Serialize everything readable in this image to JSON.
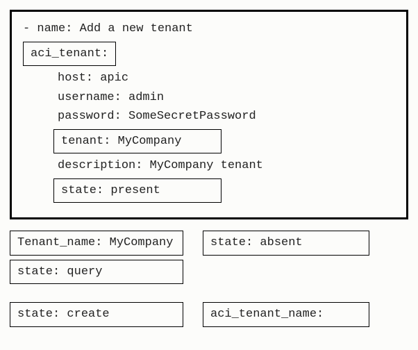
{
  "task": {
    "name_line": "- name: Add a new tenant",
    "module_line": "aci_tenant:",
    "host_line": "host: apic",
    "username_line": "username: admin",
    "password_line": "password: SomeSecretPassword",
    "tenant_line": "tenant: MyCompany",
    "description_line": "description: MyCompany tenant",
    "state_line": "state: present"
  },
  "options": {
    "tenant_name": "Tenant_name: MyCompany",
    "state_absent": "state: absent",
    "state_query": "state: query",
    "state_create": "state: create",
    "aci_tenant_name": "aci_tenant_name:"
  }
}
